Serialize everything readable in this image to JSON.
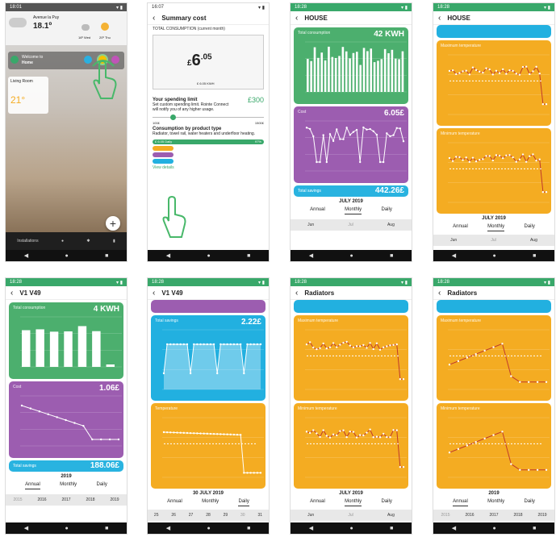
{
  "colors": {
    "green": "#4caf6e",
    "purple": "#9c5db0",
    "orange": "#f4ac22",
    "blue": "#22b0e0"
  },
  "p1": {
    "time": "18:01",
    "location": "Avenue la Puy",
    "temp": "18.1º",
    "forecast": [
      "16º Wed",
      "20º Thu"
    ],
    "welcome": "Welcome to",
    "home": "Home",
    "room": "Living Room",
    "room_temp": "21°",
    "plus": "+",
    "nav_installations": "Installations"
  },
  "p2": {
    "time": "16:07",
    "title": "Summary cost",
    "total_label": "TOTAL CONSUMPTION (current month)",
    "currency": "£",
    "amount": "6",
    "cents": ".05",
    "sub": "£ 6.05 KWH",
    "limit_title": "Your spending limit",
    "limit_amount": "£300",
    "limit_desc": "Set custom spending limit. Rointe Connect will notify you of any higher usage.",
    "slider_min": "100£",
    "slider_max": "1500£",
    "prod_title": "Consumption by product type",
    "prod_desc": "Radiator, towel rail, water heaters and underfloor heating.",
    "pill_label": "£ 6.05",
    "pill_sub": "Daily",
    "pill_pct": "97%",
    "view_details": "View details"
  },
  "p3": {
    "time": "18:28",
    "title": "HOUSE",
    "cons_label": "Total consumption",
    "cons_val": "42 KWH",
    "cost_label": "Cost",
    "cost_val": "6.05£",
    "sav_label": "Total savings",
    "sav_val": "442.26£",
    "period": "JULY 2019",
    "tabs": [
      "Annual",
      "Monthly",
      "Daily"
    ],
    "dates": [
      "Jun",
      "Jul",
      "Aug"
    ]
  },
  "p4": {
    "time": "18:28",
    "title": "HOUSE",
    "max_label": "Maximum temperature",
    "min_label": "Minimum temperature",
    "period": "JULY 2019",
    "tabs": [
      "Annual",
      "Monthly",
      "Daily"
    ],
    "dates": [
      "Jun",
      "Jul",
      "Aug"
    ]
  },
  "p5": {
    "time": "18:28",
    "title": "V1 V49",
    "cons_label": "Total consumption",
    "cons_val": "4 KWH",
    "cost_label": "Cost",
    "cost_val": "1.06£",
    "sav_label": "Total savings",
    "sav_val": "188.06£",
    "period": "2019",
    "tabs": [
      "Annual",
      "Monthly",
      "Daily"
    ],
    "dates": [
      "2015",
      "2016",
      "2017",
      "2018",
      "2019"
    ]
  },
  "p6": {
    "time": "18:28",
    "title": "V1 V49",
    "sav_label": "Total savings",
    "sav_val": "2.22£",
    "temp_label": "Temperature",
    "period": "30 JULY 2019",
    "tabs": [
      "Annual",
      "Monthly",
      "Daily"
    ],
    "dates": [
      "25",
      "26",
      "27",
      "28",
      "29",
      "30",
      "31"
    ]
  },
  "p7": {
    "time": "18:28",
    "title": "Radiators",
    "max_label": "Maximum temperature",
    "min_label": "Minimum temperature",
    "period": "JULY 2019",
    "tabs": [
      "Annual",
      "Monthly",
      "Daily"
    ],
    "dates": [
      "Jun",
      "Jul",
      "Aug"
    ]
  },
  "p8": {
    "time": "18:28",
    "title": "Radiators",
    "max_label": "Maximum temperature",
    "min_label": "Minimum temperature",
    "period": "2019",
    "tabs": [
      "Annual",
      "Monthly",
      "Daily"
    ],
    "dates": [
      "2015",
      "2016",
      "2017",
      "2018",
      "2019"
    ]
  }
}
